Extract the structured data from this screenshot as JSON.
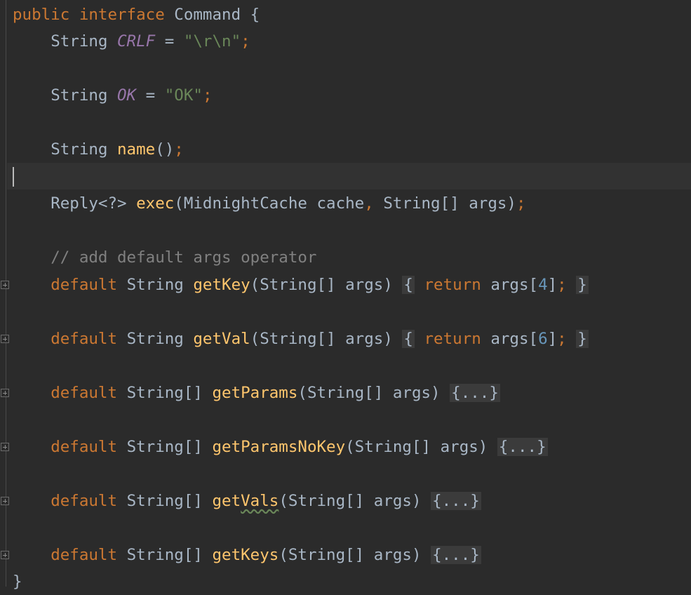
{
  "code": {
    "interface_kw": "public interface",
    "interface_name": "Command",
    "open_brace": "{",
    "close_brace": "}",
    "type_string": "String",
    "type_string_arr": "String[]",
    "kw_default": "default",
    "kw_return": "return",
    "equals": " = ",
    "semicolon": ";",
    "const_crlf": "CRLF",
    "crlf_value": "\"\\r\\n\"",
    "const_ok": "OK",
    "ok_value": "\"OK\"",
    "method_name": "name",
    "empty_parens": "()",
    "reply_type": "Reply<?>",
    "method_exec": "exec",
    "exec_params_a": "(MidnightCache cache",
    "comma": ",",
    "exec_params_b": " String[] args)",
    "comment": "// add default args operator",
    "params": "(String[] args)",
    "args_open": "args[",
    "close_bracket": "]",
    "folded_open": "{",
    "folded_close": "}",
    "folded_block": "{...}",
    "methods": {
      "get_key": "getKey",
      "get_key_index": "4",
      "get_val": "getVal",
      "get_val_index": "6",
      "get_params": "getParams",
      "get_params_no_key": "getParamsNoKey",
      "get_vals_prefix": "get",
      "get_vals_typo": "Vals",
      "get_keys": "getKeys"
    }
  }
}
